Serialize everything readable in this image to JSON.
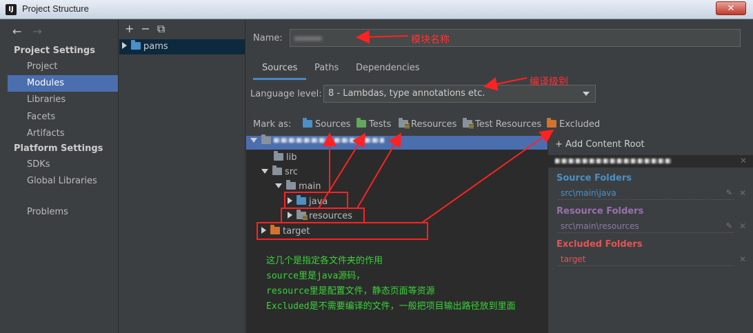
{
  "window": {
    "title": "Project Structure",
    "app_icon": "IJ",
    "close_label": "✕"
  },
  "left_nav": {
    "back_icon": "←",
    "forward_icon": "→",
    "sections": [
      {
        "title": "Project Settings",
        "items": [
          "Project",
          "Modules",
          "Libraries",
          "Facets",
          "Artifacts"
        ]
      },
      {
        "title": "Platform Settings",
        "items": [
          "SDKs",
          "Global Libraries"
        ]
      }
    ],
    "problems": "Problems",
    "selected": "Modules"
  },
  "module_list": {
    "tools": [
      "+",
      "−",
      "⧉"
    ],
    "modules": [
      "pams"
    ]
  },
  "module": {
    "name_label": "Name:",
    "tabs": [
      "Sources",
      "Paths",
      "Dependencies"
    ],
    "active_tab": "Sources",
    "language_label": "Language level:",
    "language_value": "8 - Lambdas, type annotations etc.",
    "mark_as_label": "Mark as:",
    "mark_buttons": [
      "Sources",
      "Tests",
      "Resources",
      "Test Resources",
      "Excluded"
    ],
    "tree": [
      {
        "label": "lib",
        "type": "plain"
      },
      {
        "label": "src",
        "type": "plain"
      },
      {
        "label": "main",
        "type": "plain"
      },
      {
        "label": "java",
        "type": "source"
      },
      {
        "label": "resources",
        "type": "resource"
      },
      {
        "label": "target",
        "type": "excluded"
      }
    ]
  },
  "content_root": {
    "add_label": "Add Content Root",
    "source_folders_title": "Source Folders",
    "source_folder": "src\\main\\java",
    "resource_folders_title": "Resource Folders",
    "resource_folder": "src\\main\\resources",
    "excluded_folders_title": "Excluded Folders",
    "excluded_folder": "target"
  },
  "annotations": {
    "module_name": "模块名称",
    "compile_level": "编译级别",
    "explanation": [
      "这几个是指定各文件夹的作用",
      "source里是java源码，",
      "resource里是配置文件，静态页面等资源",
      "Excluded是不需要编译的文件，一般把项目输出路径放到里面"
    ]
  },
  "colors": {
    "selection": "#4b6eaf",
    "source": "#4a90c9",
    "resource": "#9a6fb0",
    "excluded": "#e05555",
    "annotation": "#ff3333",
    "note": "#39d339"
  }
}
